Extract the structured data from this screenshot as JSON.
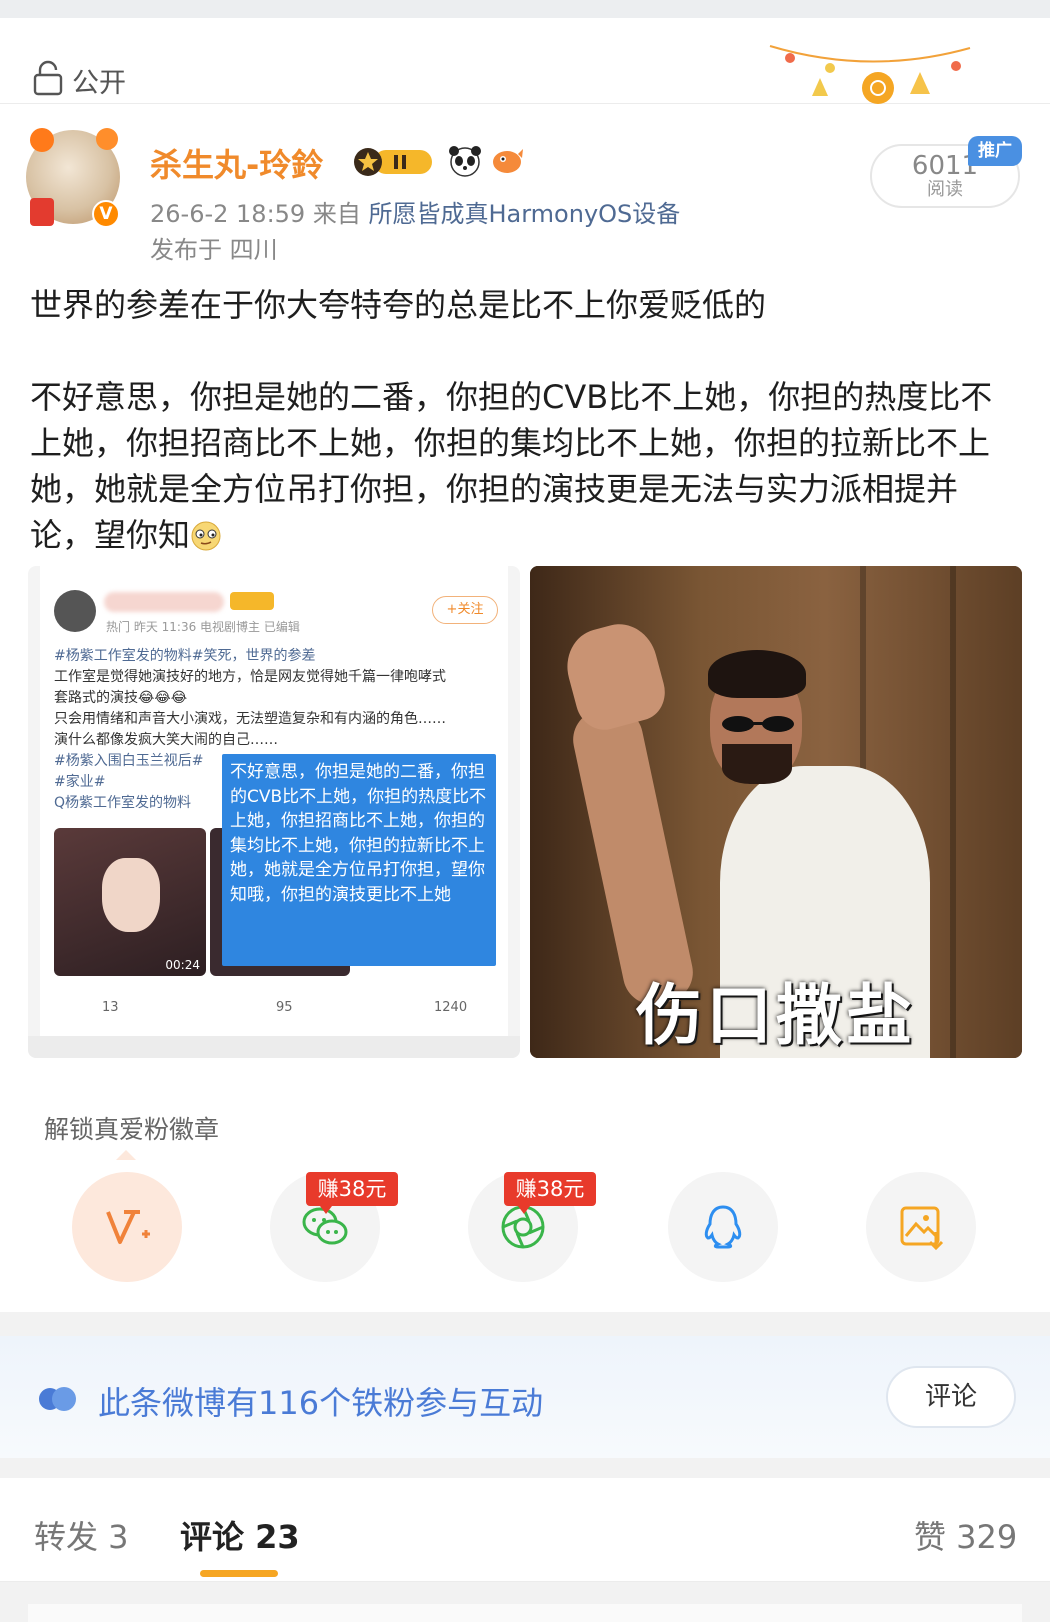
{
  "visibility": {
    "label": "公开",
    "icon": "lock-icon"
  },
  "author": {
    "name": "杀生丸-玲鈴",
    "badges": [
      "vip-level-badge",
      "panda-icon",
      "fish-icon"
    ],
    "verified_mark": "V",
    "timestamp": "26-6-2 18:59",
    "source_prefix": "来自",
    "source": "所愿皆成真HarmonyOS设备",
    "location": "发布于 四川"
  },
  "read": {
    "count": "6011",
    "label": "阅读",
    "promo_tag": "推广"
  },
  "post": {
    "line1": "世界的参差在于你大夸特夸的总是比不上你爱贬低的",
    "line2": "不好意思，你担是她的二番，你担的CVB比不上她，你担的热度比不上她，你担招商比不上她，你担的集均比不上她，你担的拉新比不上她，她就是全方位吊打你担，你担的演技更是无法与实力派相提并论，望你知"
  },
  "screenshot_card": {
    "meta": "热门  昨天 11:36  电视剧博主  已编辑",
    "follow": "+关注",
    "text_lines": [
      "#杨紫工作室发的物料#笑死，世界的参差",
      "工作室是觉得她演技好的地方，恰是网友觉得她千篇一律咆哮式",
      "套路式的演技😂😂😂",
      "只会用情绪和声音大小演戏，无法塑造复杂和有内涵的角色……",
      "演什么都像发疯大笑大闹的自己……",
      "#杨紫入围白玉兰视后#",
      "#家业#",
      "Q杨紫工作室发的物料"
    ],
    "bubble_text": "不好意思，你担是她的二番，你担的CVB比不上她，你担的热度比不上她，你担招商比不上她，你担的集均比不上她，你担的拉新比不上她，她就是全方位吊打你担，望你知哦，你担的演技更比不上她",
    "video_time": "00:24",
    "reposts": "13",
    "comments": "95",
    "likes": "1240"
  },
  "meme": {
    "caption": "伤口撒盐"
  },
  "unlock": {
    "label": "解锁真爱粉徽章"
  },
  "share": {
    "earn_tag": "赚38元",
    "items": [
      "v-plus-icon",
      "wechat-icon",
      "moments-icon",
      "qq-icon",
      "save-image-icon"
    ]
  },
  "fans": {
    "text": "此条微博有116个铁粉参与互动",
    "comment_button": "评论"
  },
  "tabs": {
    "repost": "转发 3",
    "comment": "评论 23",
    "like": "赞 329"
  },
  "colors": {
    "accent": "#f08a2b",
    "link": "#4f6a93",
    "banner_text": "#4a7bd6",
    "tab_underline": "#f6a623",
    "earn_tag": "#e83a2b"
  }
}
